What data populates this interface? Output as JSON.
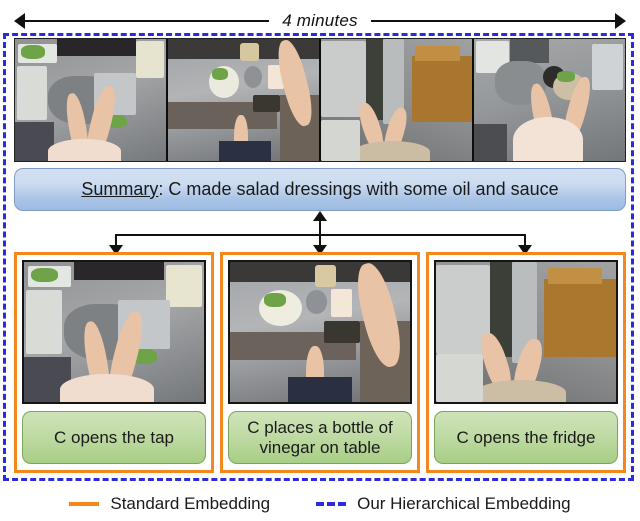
{
  "figure": {
    "duration_label": "4 minutes",
    "summary": {
      "lead": "Summary",
      "separator": ":",
      "text": "C made salad dressings with some oil and sauce"
    }
  },
  "filmstrip": {
    "frames": [
      {
        "alt": "Egocentric view of person at kitchen sink washing with greens on the left counter"
      },
      {
        "alt": "Egocentric view of stainless counter with salad plate, metal bowl and a phone"
      },
      {
        "alt": "Egocentric view of person opening a tall refrigerator door beside wooden floor"
      },
      {
        "alt": "Egocentric view of person mixing a salad bowl over a sink"
      }
    ]
  },
  "panels": [
    {
      "caption": "C opens the tap",
      "image_alt": "Hands over the kitchen sink turning the tap on"
    },
    {
      "caption": "C places a bottle of vinegar on table",
      "image_alt": "Hand placing a bottle on the kitchen counter next to a phone"
    },
    {
      "caption": "C opens the fridge",
      "image_alt": "Hands pulling open the refrigerator door"
    }
  ],
  "legend": {
    "items": [
      {
        "label": "Standard Embedding",
        "style": "solid",
        "color": "#f5871f"
      },
      {
        "label": "Our Hierarchical Embedding",
        "style": "dashed",
        "color": "#2b2bdd"
      }
    ]
  },
  "colors": {
    "standard_embedding": "#f5871f",
    "hierarchical_embedding": "#2b2bdd",
    "summary_fill_top": "#d3e0f2",
    "summary_fill_bottom": "#9dbbe2",
    "caption_fill_top": "#cfe3b8",
    "caption_fill_bottom": "#a8ce86"
  }
}
